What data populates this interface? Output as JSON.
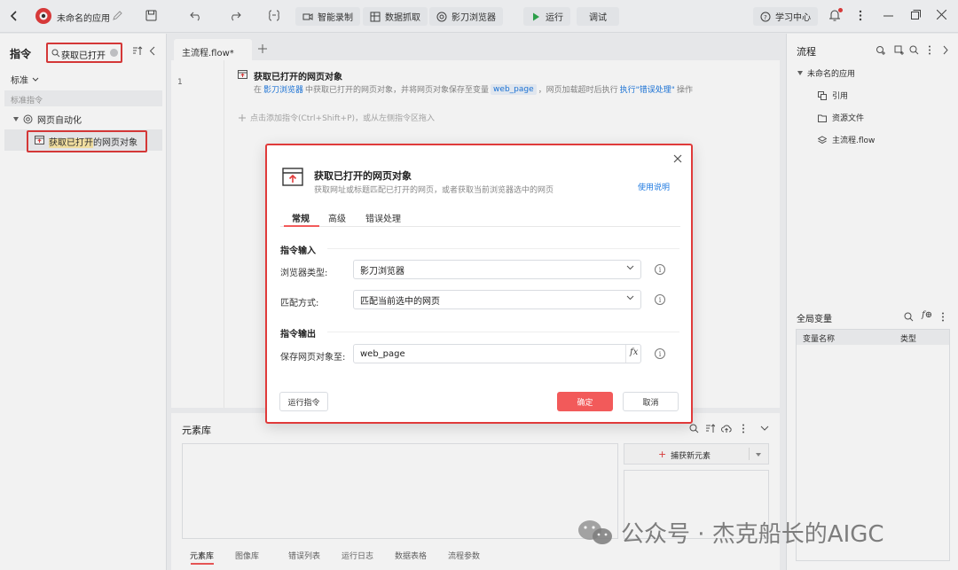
{
  "topbar": {
    "app_name": "未命名的应用",
    "buttons": {
      "record": "智能录制",
      "capture": "数据抓取",
      "browser": "影刀浏览器",
      "run": "运行",
      "debug": "调试",
      "learn": "学习中心"
    }
  },
  "left": {
    "title": "指令",
    "search_value": "获取已打开",
    "filter_label": "标准",
    "section_label": "标准指令",
    "tree": {
      "group": "网页自动化",
      "item": "获取已打开的网页对象"
    }
  },
  "editor": {
    "tab": "主流程.flow*",
    "line_number": "1",
    "step": {
      "title": "获取已打开的网页对象",
      "desc_prefix": "在",
      "desc_browser": "影刀浏览器",
      "desc_mid": "中获取已打开的网页对象，并将网页对象保存至变量",
      "desc_var": "web_page",
      "desc_mid2": "，网页加载超时后执行",
      "desc_action": "执行\"错误处理\"",
      "desc_suffix": "操作"
    },
    "add_hint": "点击添加指令(Ctrl+Shift+P)，或从左侧指令区拖入"
  },
  "right": {
    "flow_title": "流程",
    "tree_root": "未命名的应用",
    "tree_items": [
      "引用",
      "资源文件",
      "主流程.flow"
    ],
    "globals_title": "全局变量",
    "table_headers": [
      "变量名称",
      "类型"
    ]
  },
  "elemlib": {
    "title": "元素库",
    "capture_btn": "捕获新元素",
    "tabs": [
      "元素库",
      "图像库",
      "错误列表",
      "运行日志",
      "数据表格",
      "流程参数"
    ]
  },
  "dialog": {
    "title": "获取已打开的网页对象",
    "subtitle": "获取网址或标题匹配已打开的网页，或者获取当前浏览器选中的网页",
    "help_link": "使用说明",
    "tabs": [
      "常规",
      "高级",
      "错误处理"
    ],
    "input_section": "指令输入",
    "browser_type_label": "浏览器类型:",
    "browser_type_value": "影刀浏览器",
    "match_label": "匹配方式:",
    "match_value": "匹配当前选中的网页",
    "output_section": "指令输出",
    "save_label": "保存网页对象至:",
    "save_value": "web_page",
    "fx_label": "fx",
    "run_btn": "运行指令",
    "ok_btn": "确定",
    "cancel_btn": "取消"
  },
  "watermark": "公众号 · 杰克船长的AIGC",
  "colors": {
    "accent_red": "#f25a5a",
    "link_blue": "#1f7ae0",
    "run_green": "#2fa84f",
    "highlight_outline": "#e03a3a"
  }
}
